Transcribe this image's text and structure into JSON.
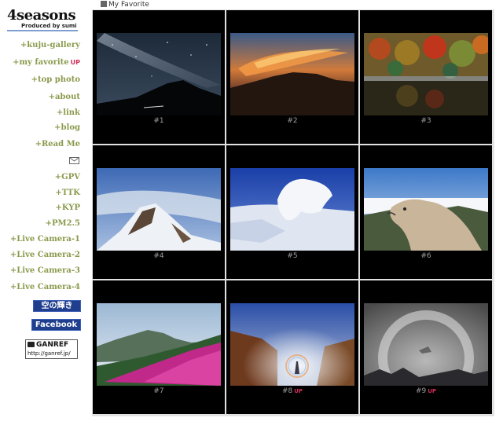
{
  "logo": {
    "title": "4seasons",
    "subtitle": "Produced by sumi"
  },
  "nav": [
    {
      "label": "+kuju-gallery"
    },
    {
      "label": "+my favorite",
      "badge": "UP"
    },
    {
      "label": "+top photo"
    },
    {
      "label": "+about"
    },
    {
      "label": "+link"
    },
    {
      "label": "+blog"
    },
    {
      "label": "+Read Me"
    },
    {
      "label": "+GPV"
    },
    {
      "label": "+TTK"
    },
    {
      "label": "+KYP"
    },
    {
      "label": "+PM2.5"
    },
    {
      "label": "+Live Camera-1"
    },
    {
      "label": "+Live Camera-2"
    },
    {
      "label": "+Live Camera-3"
    },
    {
      "label": "+Live Camera-4"
    }
  ],
  "mail_icon": "mail-icon",
  "banners": {
    "sora": "空の輝き",
    "facebook": "Facebook",
    "ganref_title": "GANREF",
    "ganref_url": "http://ganref.jp/"
  },
  "page_heading": "My Favorite",
  "gallery": [
    {
      "caption": "#1",
      "subject": "milky way night sky"
    },
    {
      "caption": "#2",
      "subject": "fiery sunset clouds"
    },
    {
      "caption": "#3",
      "subject": "autumn pond reflection"
    },
    {
      "caption": "#4",
      "subject": "snowy ridge"
    },
    {
      "caption": "#5",
      "subject": "rime ice formation"
    },
    {
      "caption": "#6",
      "subject": "dog on mountain"
    },
    {
      "caption": "#7",
      "subject": "pink azalea slope"
    },
    {
      "caption": "#8",
      "subject": "brocken spectre",
      "badge": "UP"
    },
    {
      "caption": "#9",
      "subject": "fog bow",
      "badge": "UP"
    }
  ],
  "colors": {
    "nav": "#8a9a4c",
    "badge": "#d0305a",
    "banner": "#1f3e8e"
  }
}
